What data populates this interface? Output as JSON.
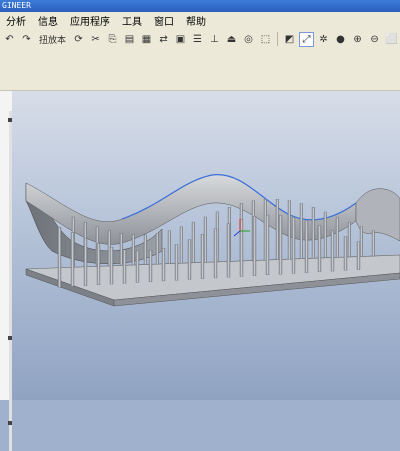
{
  "window": {
    "title": "GINEER"
  },
  "menubar": {
    "items": [
      "分析",
      "信息",
      "应用程序",
      "工具",
      "窗口",
      "帮助"
    ]
  },
  "toolbar": {
    "text_label": "扭放本"
  },
  "colors": {
    "accent": "#2a5fbc",
    "model": "#b4b8be",
    "curve_highlight": "#3a6fd8"
  }
}
